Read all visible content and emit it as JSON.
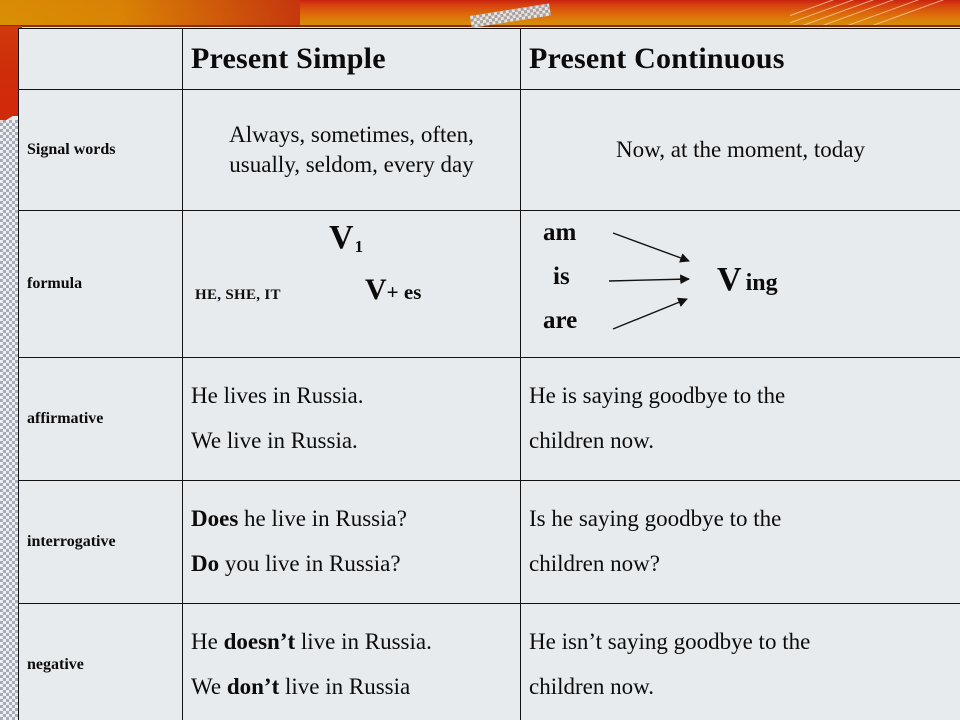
{
  "slide": {
    "background_color": "#e8ebee",
    "banner_colors": {
      "red": "#c9220f",
      "orange": "#dd6a0b",
      "gold": "#cf8c06",
      "rule": "#8d2b06"
    }
  },
  "table": {
    "columns": [
      {
        "key": "label",
        "header": ""
      },
      {
        "key": "present_simple",
        "header": "Present Simple"
      },
      {
        "key": "present_continuous",
        "header": "Present Continuous"
      }
    ],
    "rows": [
      {
        "label": "Signal words",
        "present_simple": "Always, sometimes, often, usually, seldom, every day",
        "present_simple_lines": [
          "Always, sometimes,",
          "often, usually, seldom,",
          "every day"
        ],
        "present_continuous": "Now, at the moment, today"
      },
      {
        "label": "formula",
        "present_simple_formula": {
          "base": "V",
          "base_subscript": "1",
          "pronouns": "HE, SHE, IT",
          "suffix_verb": "V",
          "suffix": "+ es"
        },
        "present_continuous_formula": {
          "auxiliaries": [
            "am",
            "is",
            "are"
          ],
          "verb": "V",
          "ending": "ing",
          "arrows": 3
        }
      },
      {
        "label": "affirmative",
        "present_simple_lines": [
          {
            "parts": [
              {
                "text": "He lives in Russia.",
                "bold": false
              }
            ]
          },
          {
            "parts": [
              {
                "text": "We live in Russia.",
                "bold": false
              }
            ]
          }
        ],
        "present_continuous_lines": [
          {
            "parts": [
              {
                "text": "He is saying goodbye to the",
                "bold": false
              }
            ]
          },
          {
            "parts": [
              {
                "text": "children now.",
                "bold": false
              }
            ]
          }
        ]
      },
      {
        "label": "interrogative",
        "present_simple_lines": [
          {
            "parts": [
              {
                "text": "Does",
                "bold": true
              },
              {
                "text": " he live in Russia?",
                "bold": false
              }
            ]
          },
          {
            "parts": [
              {
                "text": "Do",
                "bold": true
              },
              {
                "text": " you live in Russia?",
                "bold": false
              }
            ]
          }
        ],
        "present_continuous_lines": [
          {
            "parts": [
              {
                "text": "Is he saying goodbye to the",
                "bold": false
              }
            ]
          },
          {
            "parts": [
              {
                "text": "children now?",
                "bold": false
              }
            ]
          }
        ]
      },
      {
        "label": "negative",
        "present_simple_lines": [
          {
            "parts": [
              {
                "text": "He ",
                "bold": false
              },
              {
                "text": "doesn’t",
                "bold": true
              },
              {
                "text": " live in Russia.",
                "bold": false
              }
            ]
          },
          {
            "parts": [
              {
                "text": "We ",
                "bold": false
              },
              {
                "text": "don’t",
                "bold": true
              },
              {
                "text": " live in Russia",
                "bold": false
              }
            ]
          }
        ],
        "present_continuous_lines": [
          {
            "parts": [
              {
                "text": "He isn’t saying goodbye to the",
                "bold": false
              }
            ]
          },
          {
            "parts": [
              {
                "text": "children now.",
                "bold": false
              }
            ]
          }
        ]
      }
    ]
  }
}
